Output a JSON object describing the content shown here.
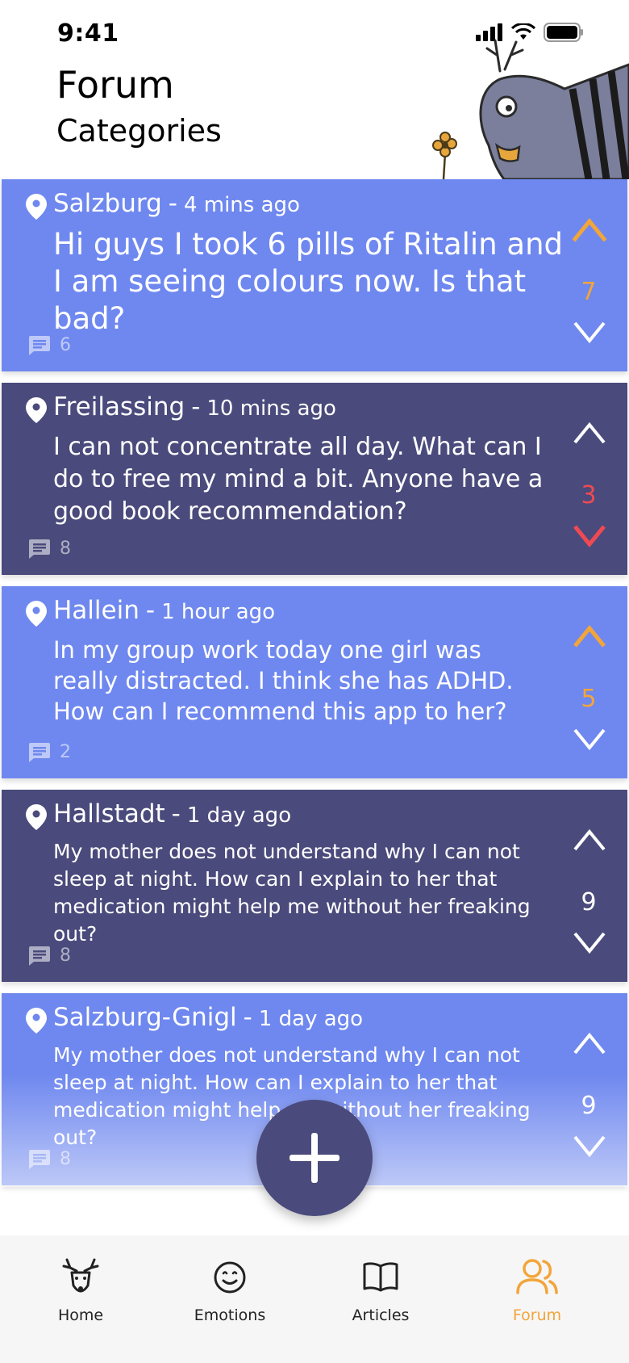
{
  "status_bar": {
    "time": "9:41"
  },
  "header": {
    "title": "Forum",
    "subtitle": "Categories"
  },
  "colors": {
    "card_light": "#6f88ef",
    "card_dark": "#4a4a7c",
    "accent_orange": "#f2a53a",
    "downvote_red": "#ef4a53",
    "tabbar_bg": "#f6f6f6"
  },
  "posts": [
    {
      "location": "Salzburg",
      "time_ago": "4 mins ago",
      "text": "Hi guys I took 6 pills of Ritalin and I am seeing colours now. Is that bad?",
      "comments": "6",
      "votes": "7",
      "vote_state": "up",
      "theme": "light"
    },
    {
      "location": "Freilassing",
      "time_ago": "10 mins ago",
      "text": "I can not concentrate all day. What can I do to free my mind a bit. Anyone have a good book recommendation?",
      "comments": "8",
      "votes": "3",
      "vote_state": "down",
      "theme": "dark"
    },
    {
      "location": "Hallein",
      "time_ago": "1 hour ago",
      "text": "In my group work today one girl was really distracted. I think she has ADHD. How can I recommend this app to her?",
      "comments": "2",
      "votes": "5",
      "vote_state": "up",
      "theme": "light"
    },
    {
      "location": "Hallstadt",
      "time_ago": "1 day ago",
      "text": "My mother does not understand why I can not sleep at night. How can I explain to her that medication might help me without her freaking out?",
      "comments": "8",
      "votes": "9",
      "vote_state": "none",
      "theme": "dark"
    },
    {
      "location": "Salzburg-Gnigl",
      "time_ago": "1 day ago",
      "text": "My mother does not understand why I can not sleep at night. How can I explain to her that medication might help me without her freaking out?",
      "comments": "8",
      "votes": "9",
      "vote_state": "none",
      "theme": "light"
    }
  ],
  "fab": {
    "icon": "plus-icon"
  },
  "tabs": [
    {
      "label": "Home",
      "icon": "deer-icon",
      "active": false
    },
    {
      "label": "Emotions",
      "icon": "smiley-icon",
      "active": false
    },
    {
      "label": "Articles",
      "icon": "book-icon",
      "active": false
    },
    {
      "label": "Forum",
      "icon": "users-icon",
      "active": true
    }
  ]
}
